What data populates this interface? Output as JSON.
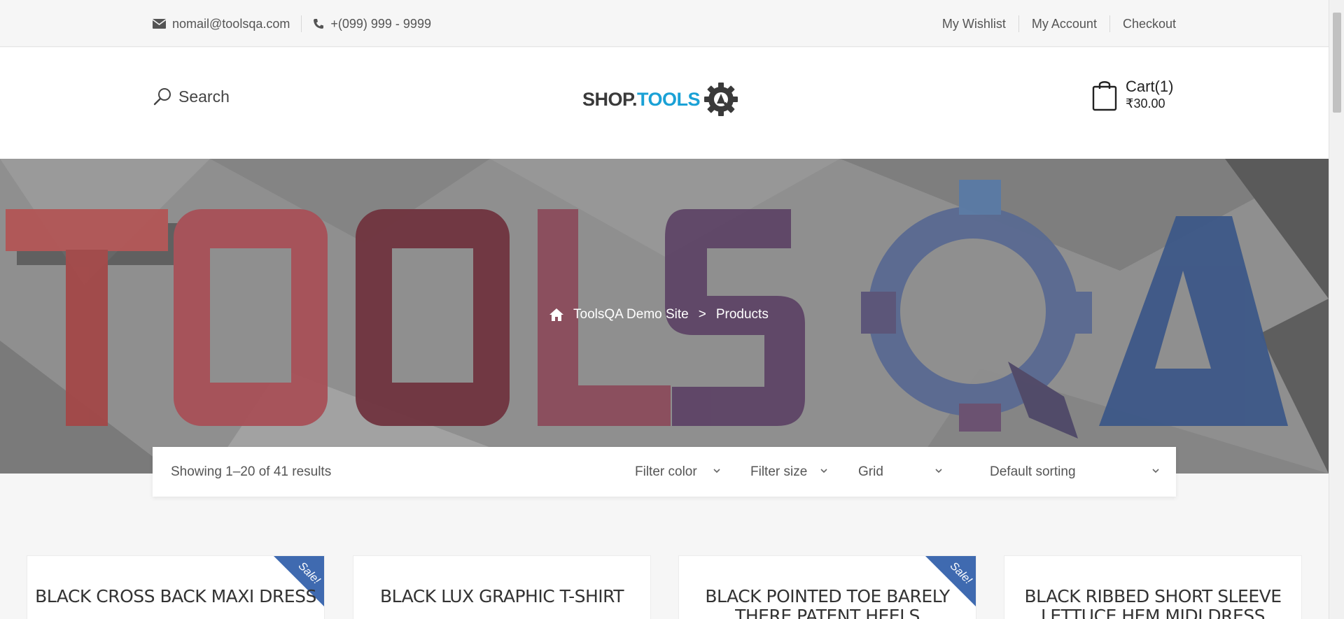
{
  "topbar": {
    "email": "nomail@toolsqa.com",
    "phone": "+(099) 999 - 9999",
    "links": [
      "My Wishlist",
      "My Account",
      "Checkout"
    ]
  },
  "header": {
    "search_label": "Search",
    "logo": {
      "part1": "SHOP.",
      "part2": "TOOLS"
    },
    "cart": {
      "label": "Cart(1)",
      "total": "₹30.00"
    }
  },
  "hero": {
    "breadcrumb": {
      "home": "ToolsQA Demo Site",
      "separator": ">",
      "current": "Products"
    }
  },
  "toolbar": {
    "results": "Showing 1–20 of 41 results",
    "filter_color": "Filter color",
    "filter_size": "Filter size",
    "view": "Grid",
    "sorting": "Default sorting"
  },
  "products": [
    {
      "title": "BLACK CROSS BACK MAXI DRESS",
      "sale": "Sale!"
    },
    {
      "title": "BLACK LUX GRAPHIC T-SHIRT",
      "sale": ""
    },
    {
      "title": "BLACK POINTED TOE BARELY THERE PATENT HEELS",
      "sale": "Sale!"
    },
    {
      "title": "BLACK RIBBED SHORT SLEEVE LETTUCE HEM MIDI DRESS",
      "sale": ""
    }
  ],
  "colors": {
    "accent": "#1aa1d6",
    "sale": "#3f6ab0"
  }
}
